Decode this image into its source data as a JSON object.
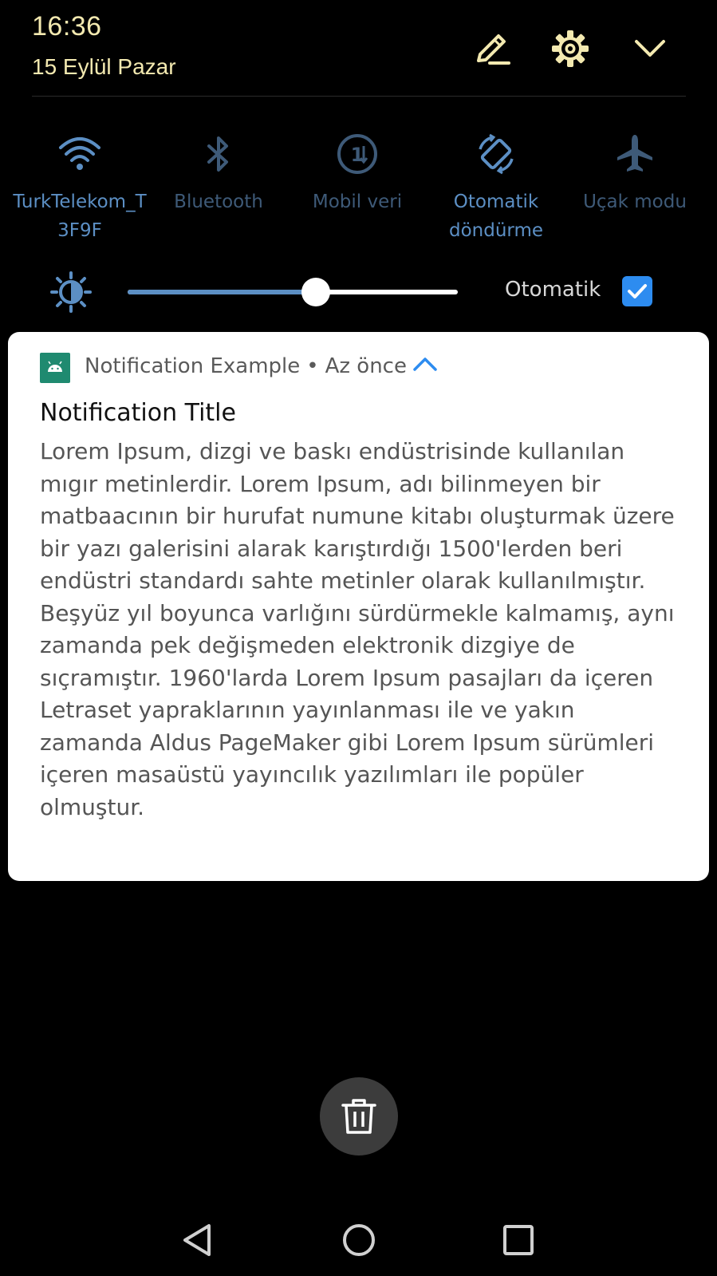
{
  "status": {
    "time": "16:36",
    "date": "15 Eylül Pazar"
  },
  "header_icons": [
    "edit-icon",
    "settings-gear-icon",
    "collapse-chevron-icon"
  ],
  "quick_settings": {
    "tiles": [
      {
        "label": "TurkTelekom_T\n3F9F",
        "icon": "wifi-icon",
        "active": true
      },
      {
        "label": "Bluetooth",
        "icon": "bluetooth-icon",
        "active": false
      },
      {
        "label": "Mobil veri",
        "icon": "mobile-data-icon",
        "active": false
      },
      {
        "label": "Otomatik\ndöndürme",
        "icon": "auto-rotate-icon",
        "active": true
      },
      {
        "label": "Uçak modu",
        "icon": "airplane-icon",
        "active": false
      }
    ]
  },
  "brightness": {
    "level": 0.57,
    "auto_label": "Otomatik",
    "auto_checked": true
  },
  "notification": {
    "app_name": "Notification Example",
    "separator": "•",
    "time": "Az önce",
    "title": "Notification Title",
    "body": "Lorem Ipsum, dizgi ve baskı endüstrisinde kullanılan mıgır metinlerdir. Lorem Ipsum, adı bilinmeyen bir matbaacının bir hurufat numune kitabı oluşturmak üzere bir yazı galerisini alarak karıştırdığı 1500'lerden beri endüstri standardı sahte metinler olarak kullanılmıştır. Beşyüz yıl boyunca varlığını sürdürmekle kalmamış, aynı zamanda pek değişmeden elektronik dizgiye de sıçramıştır. 1960'larda Lorem Ipsum pasajları da içeren Letraset yapraklarının yayınlanması ile ve yakın zamanda Aldus PageMaker gibi Lorem Ipsum sürümleri içeren masaüstü yayıncılık yazılımları ile popüler olmuştur."
  },
  "colors": {
    "clock": "#f3e9b0",
    "tile_active": "#5c8fc4",
    "tile_inactive": "#3e5a78",
    "checkbox": "#2d8cf0",
    "app_icon": "#1f8a70",
    "chevron_accent": "#2d8cf0"
  },
  "nav": [
    "back-icon",
    "home-icon",
    "recents-icon"
  ]
}
